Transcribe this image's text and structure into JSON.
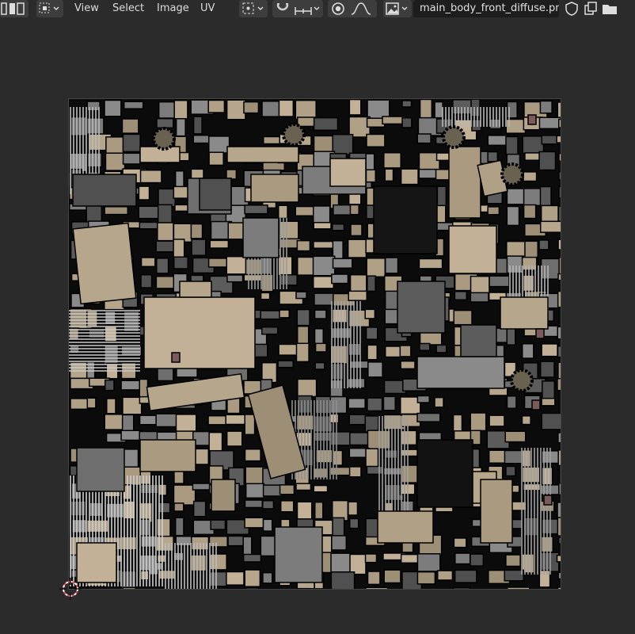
{
  "header": {
    "editor_type_icon": "image-editor-icon",
    "mode_icon": "uv-select-mode-icon",
    "menus": [
      "View",
      "Select",
      "Image",
      "UV"
    ],
    "pivot_icon": "pivot-point-icon",
    "snap_icon": "snap-magnet-icon",
    "snap_target_icon": "snap-increment-icon",
    "proportional_icon": "proportional-edit-icon",
    "falloff_icon": "falloff-curve-icon",
    "image_browse_icon": "image-browse-icon",
    "image_name": "main_body_front_diffuse.png",
    "fake_user_icon": "shield-icon",
    "duplicate_icon": "duplicate-icon",
    "open_icon": "folder-icon"
  },
  "viewport": {
    "image_label": "main_body_front_diffuse.png texture",
    "cursor_icon": "2d-cursor-icon"
  },
  "colors": {
    "background": "#2b2b2b",
    "header_button": "#3d3d3d",
    "texture_tan": "#b5a58a",
    "texture_gray": "#6c6c6c",
    "texture_dark": "#0b0b0b",
    "cursor_red": "#e04848"
  }
}
